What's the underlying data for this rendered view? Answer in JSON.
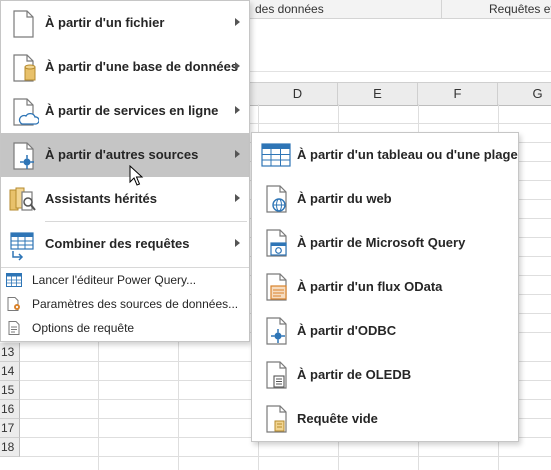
{
  "ribbon": {
    "group1": "des données",
    "group2": "Requêtes et"
  },
  "sheet": {
    "columns": [
      "D",
      "E",
      "F",
      "G"
    ],
    "rows": [
      "13",
      "14",
      "15",
      "16",
      "17",
      "18"
    ]
  },
  "main_menu": {
    "items": [
      {
        "label": "À partir d'un fichier"
      },
      {
        "label": "À partir d'une base de données"
      },
      {
        "label": "À partir de services en ligne"
      },
      {
        "label": "À partir d'autres sources"
      },
      {
        "label": "Assistants hérités"
      },
      {
        "label": "Combiner des requêtes"
      }
    ],
    "small_items": [
      {
        "label": "Lancer l'éditeur Power Query..."
      },
      {
        "label": "Paramètres des sources de données..."
      },
      {
        "label": "Options de requête"
      }
    ]
  },
  "submenu": {
    "items": [
      {
        "label": "À partir d'un tableau ou d'une plage"
      },
      {
        "label": "À partir du web"
      },
      {
        "label": "À partir de Microsoft Query"
      },
      {
        "label": "À partir d'un flux OData"
      },
      {
        "label": "À partir d'ODBC"
      },
      {
        "label": "À partir de OLEDB"
      },
      {
        "label": "Requête vide"
      }
    ]
  },
  "colors": {
    "highlight": "#c5c5c5",
    "icon_blue": "#2e75b6",
    "icon_gold": "#e8c16b",
    "icon_orange": "#d9822b"
  }
}
